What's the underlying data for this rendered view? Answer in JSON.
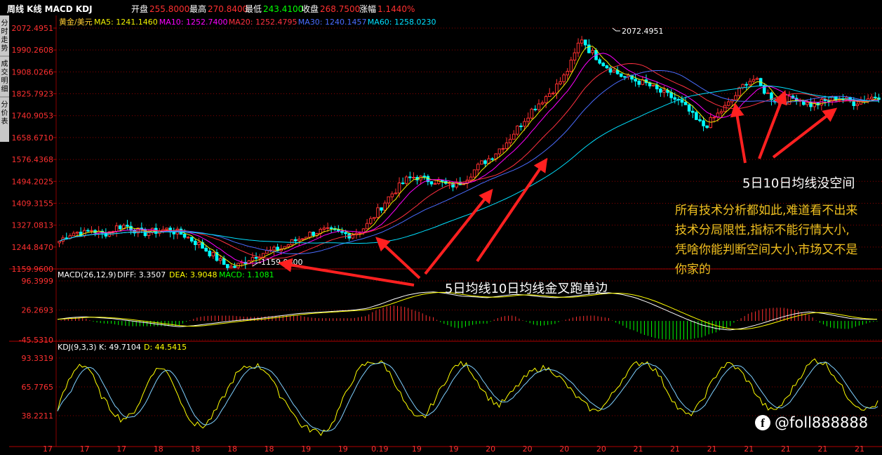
{
  "header": {
    "title": "周线 K线 MACD KDJ",
    "open_label": "开盘",
    "open": "255.8000",
    "high_label": "最高",
    "high": "270.8400",
    "low_label": "最低",
    "low": "243.4100",
    "close_label": "收盘",
    "close": "268.7500",
    "change_label": "涨幅",
    "change": "1.1440%"
  },
  "side_tabs": [
    {
      "label": "分时走势"
    },
    {
      "label": "成交明细"
    },
    {
      "label": "分价表"
    }
  ],
  "ma_legend": {
    "symbol": "黄金/美元",
    "items": [
      {
        "label": "MA5: 1241.1460",
        "color": "#f0f000"
      },
      {
        "label": "MA10: 1252.7400",
        "color": "#ff00ff"
      },
      {
        "label": "MA20: 1252.4795",
        "color": "#ff3040"
      },
      {
        "label": "MA30: 1240.1457",
        "color": "#4a6cff"
      },
      {
        "label": "MA60: 1258.0230",
        "color": "#00e0ff"
      }
    ]
  },
  "price_axis": [
    "2072.4951",
    "1990.2608",
    "1908.0266",
    "1825.7923",
    "1740.9053",
    "1658.6710",
    "1576.4368",
    "1494.2025",
    "1409.3155",
    "1327.0813",
    "1244.8470",
    "1159.9600"
  ],
  "price_annotations": {
    "max": "2072.4951",
    "min": "1159.9600"
  },
  "macd": {
    "legend_name": "MACD(26,12,9)",
    "diff": "DIFF: 3.3507",
    "dea": "DEA: 3.9048",
    "macd": "MACD: 1.1081",
    "axis": [
      "96.3999",
      "26.2693",
      "-45.5310"
    ]
  },
  "kdj": {
    "legend_name": "KDJ(9,3,3)",
    "k": "K: 49.7104",
    "d": "D: 44.5415",
    "axis": [
      "93.3319",
      "65.7765",
      "38.2211"
    ]
  },
  "time_axis": [
    "17",
    "17",
    "17",
    "18",
    "18",
    "18",
    "18",
    "19",
    "19",
    "0.19",
    "19",
    "19",
    "20",
    "20",
    "20",
    "20",
    "21",
    "21",
    "21",
    "21",
    "21",
    "21",
    "21"
  ],
  "annotations": {
    "caption_right": "5日10日均线没空间",
    "caption_bottom": "5日均线10日均线金叉跑单边",
    "note": "所有技术分析都如此,难道看不出来技术分局限性,指标不能行情大小,凭啥你能判断空间大小,市场又不是你家的",
    "watermark": "@foll888888"
  },
  "colors": {
    "up": "#ff3030",
    "down": "#00ffff",
    "arrow": "#ff2020",
    "grid": "#8a0000"
  },
  "chart_data": {
    "type": "candlestick",
    "title": "周线 K线 MACD KDJ",
    "ylim": [
      1159.96,
      2072.4951
    ],
    "close_path": [
      1265,
      1290,
      1300,
      1295,
      1310,
      1290,
      1300,
      1320,
      1325,
      1310,
      1295,
      1300,
      1305,
      1310,
      1300,
      1290,
      1270,
      1250,
      1225,
      1200,
      1175,
      1165,
      1180,
      1200,
      1215,
      1225,
      1230,
      1240,
      1260,
      1275,
      1290,
      1300,
      1305,
      1300,
      1295,
      1290,
      1300,
      1320,
      1360,
      1400,
      1440,
      1470,
      1500,
      1510,
      1500,
      1495,
      1490,
      1475,
      1480,
      1500,
      1530,
      1560,
      1580,
      1610,
      1640,
      1680,
      1720,
      1760,
      1790,
      1820,
      1850,
      1890,
      1950,
      2040,
      1990,
      1960,
      1930,
      1910,
      1890,
      1880,
      1870,
      1860,
      1840,
      1825,
      1810,
      1790,
      1760,
      1720,
      1700,
      1730,
      1760,
      1790,
      1830,
      1870,
      1880,
      1840,
      1810,
      1790,
      1800,
      1810,
      1790,
      1780,
      1790,
      1800,
      1810,
      1800,
      1790,
      1800,
      1810,
      1815
    ],
    "macd_path": [
      4,
      8,
      10,
      8,
      6,
      2,
      -2,
      -6,
      -10,
      -14,
      -12,
      -8,
      -4,
      0,
      3,
      6,
      10,
      14,
      18,
      20,
      22,
      24,
      26,
      30,
      40,
      52,
      62,
      68,
      70,
      66,
      60,
      58,
      56,
      60,
      64,
      62,
      58,
      56,
      58,
      62,
      66,
      68,
      64,
      56,
      44,
      30,
      16,
      2,
      -10,
      -18,
      -22,
      -18,
      -10,
      0,
      10,
      18,
      22,
      18,
      12,
      6,
      4,
      4
    ],
    "macd_ylim": [
      -45.531,
      96.3999
    ],
    "kdj_path": [
      45,
      70,
      88,
      84,
      60,
      45,
      35,
      38,
      55,
      80,
      85,
      70,
      45,
      30,
      28,
      42,
      60,
      78,
      85,
      86,
      80,
      60,
      48,
      30,
      25,
      22,
      28,
      50,
      72,
      86,
      90,
      88,
      72,
      50,
      35,
      38,
      56,
      74,
      88,
      86,
      70,
      55,
      48,
      58,
      70,
      80,
      84,
      82,
      72,
      60,
      50,
      42,
      48,
      62,
      78,
      88,
      90,
      80,
      62,
      45,
      38,
      48,
      66,
      84,
      88,
      80,
      66,
      50,
      42,
      50,
      66,
      82,
      92,
      88,
      75,
      58,
      48,
      44,
      50
    ],
    "kdj_ylim": [
      10,
      100
    ]
  }
}
